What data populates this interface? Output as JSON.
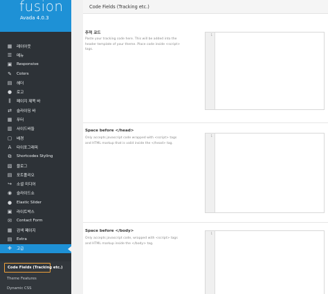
{
  "app": {
    "logo": "fusion",
    "version": "Avada 4.0.3"
  },
  "sidebar": {
    "items": [
      {
        "icon": "grid-icon",
        "glyph": "▦",
        "label": "레이아웃"
      },
      {
        "icon": "list-icon",
        "glyph": "☰",
        "label": "메뉴"
      },
      {
        "icon": "responsive-icon",
        "glyph": "▣",
        "label": "Responsive"
      },
      {
        "icon": "brush-icon",
        "glyph": "✎",
        "label": "Colors"
      },
      {
        "icon": "header-icon",
        "glyph": "▤",
        "label": "헤더"
      },
      {
        "icon": "info-icon",
        "glyph": "●",
        "label": "로고"
      },
      {
        "icon": "sliders-icon",
        "glyph": "⫼",
        "label": "페이지 제목 바"
      },
      {
        "icon": "slider-icon",
        "glyph": "⇄",
        "label": "슬라이딩 바"
      },
      {
        "icon": "footer-icon",
        "glyph": "▦",
        "label": "푸터"
      },
      {
        "icon": "sidebar-icon",
        "glyph": "▥",
        "label": "사이드바들"
      },
      {
        "icon": "background-icon",
        "glyph": "▢",
        "label": "배경"
      },
      {
        "icon": "typography-icon",
        "glyph": "A",
        "label": "타이포그래피"
      },
      {
        "icon": "shortcodes-icon",
        "glyph": "⧉",
        "label": "Shortcodes Styling"
      },
      {
        "icon": "blog-icon",
        "glyph": "▧",
        "label": "블로그"
      },
      {
        "icon": "portfolio-icon",
        "glyph": "▤",
        "label": "포트폴리오"
      },
      {
        "icon": "share-icon",
        "glyph": "↪",
        "label": "소셜 미디어"
      },
      {
        "icon": "slideshow-icon",
        "glyph": "◉",
        "label": "슬라이드쇼"
      },
      {
        "icon": "elastic-icon",
        "glyph": "●",
        "label": "Elastic Slider"
      },
      {
        "icon": "lightbox-icon",
        "glyph": "▣",
        "label": "라이트박스"
      },
      {
        "icon": "mail-icon",
        "glyph": "✉",
        "label": "Contact Form"
      },
      {
        "icon": "search-icon",
        "glyph": "▦",
        "label": "검색 페이지"
      },
      {
        "icon": "extra-icon",
        "glyph": "▤",
        "label": "Extra"
      },
      {
        "icon": "advanced-icon",
        "glyph": "✚",
        "label": "고급"
      }
    ],
    "submenu": [
      "Code Fields (Tracking etc.)",
      "Theme Features",
      "Dynamic CSS"
    ]
  },
  "main": {
    "title": "Code Fields (Tracking etc.)",
    "sections": [
      {
        "name": "추적 코드",
        "desc": "Paste your tracking code here. This will be added into the header template of your theme. Place code inside <script> tags.",
        "line": "1"
      },
      {
        "name": "Space before </head>",
        "desc": "Only accepts javascript code wrapped with <script> tags and HTML markup that is valid inside the </head> tag.",
        "line": "1"
      },
      {
        "name": "Space before </body>",
        "desc": "Only accepts javascript code, wrapped with <script> tags and HTML markup inside the </body> tag.",
        "line": "1"
      }
    ]
  }
}
